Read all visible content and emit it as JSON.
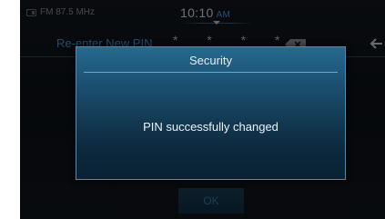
{
  "status_bar": {
    "radio": "FM 87.5 MHz",
    "clock": {
      "time": "10:10",
      "ampm": "AM"
    }
  },
  "pin_entry": {
    "label": "Re-enter New PIN",
    "masked_value": "* * * *",
    "backspace_icon": "backspace-icon",
    "back_icon": "back-arrow-icon"
  },
  "footer": {
    "ok_label": "OK"
  },
  "dialog": {
    "title": "Security",
    "message": "PIN successfully changed"
  },
  "colors": {
    "accent": "#3e91c8",
    "ampm": "#3f8fd0",
    "pin_label": "#3f86c7"
  }
}
